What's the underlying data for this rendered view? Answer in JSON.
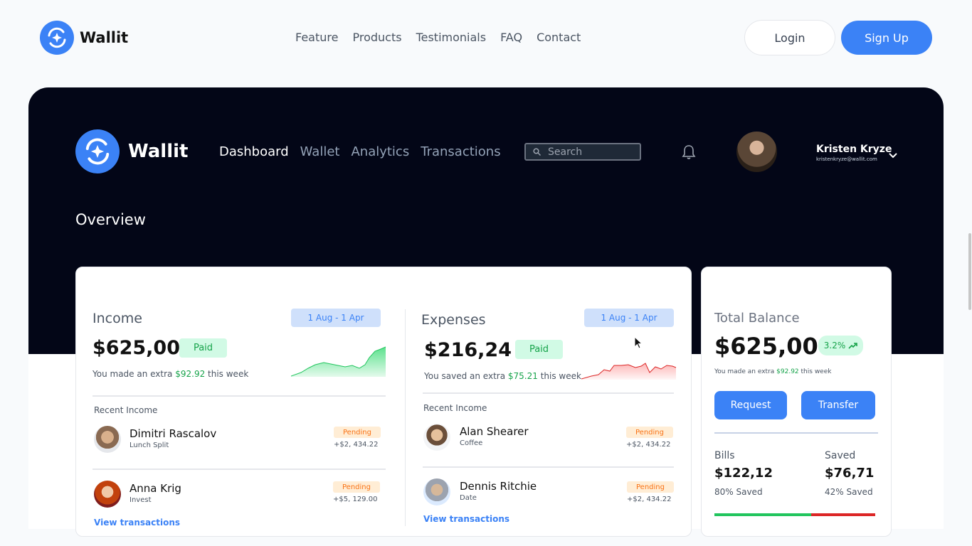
{
  "site": {
    "brand": "Wallit",
    "nav": [
      "Feature",
      "Products",
      "Testimonials",
      "FAQ",
      "Contact"
    ],
    "login": "Login",
    "signup": "Sign Up"
  },
  "dashboard": {
    "brand": "Wallit",
    "tabs": [
      "Dashboard",
      "Wallet",
      "Analytics",
      "Transactions"
    ],
    "active_tab": "Dashboard",
    "search_placeholder": "Search",
    "user": {
      "name": "Kristen Kryze",
      "email": "kristenkryze@wallit.com"
    },
    "overview": "Overview"
  },
  "income": {
    "title": "Income",
    "date_range": "1 Aug - 1 Apr",
    "amount": "$625,00",
    "status": "Paid",
    "note_pre": "You made an extra ",
    "note_val": "$92.92",
    "note_post": " this week",
    "recent_label": "Recent Income",
    "items": [
      {
        "name": "Dimitri Rascalov",
        "sub": "Lunch Split",
        "status": "Pending",
        "amount": "+$2, 434.22"
      },
      {
        "name": "Anna Krig",
        "sub": "Invest",
        "status": "Pending",
        "amount": "+$5, 129.00"
      }
    ],
    "view_link": "View transactions"
  },
  "expenses": {
    "title": "Expenses",
    "date_range": "1 Aug - 1 Apr",
    "amount": "$216,24",
    "status": "Paid",
    "note_pre": "You saved an extra ",
    "note_val": "$75.21",
    "note_post": " this week",
    "recent_label": "Recent Income",
    "items": [
      {
        "name": "Alan Shearer",
        "sub": "Coffee",
        "status": "Pending",
        "amount": "+$2, 434.22"
      },
      {
        "name": "Dennis Ritchie",
        "sub": "Date",
        "status": "Pending",
        "amount": "+$2, 434.22"
      }
    ],
    "view_link": "View transactions"
  },
  "balance": {
    "title": "Total Balance",
    "amount": "$625,00",
    "change": "3.2%",
    "note_pre": "You made an extra ",
    "note_val": "$92.92",
    "note_post": " this week",
    "request": "Request",
    "transfer": "Transfer",
    "bills": {
      "label": "Bills",
      "value": "$122,12",
      "sub": "80% Saved"
    },
    "saved": {
      "label": "Saved",
      "value": "$76,71",
      "sub": "42% Saved"
    },
    "bills_share": 0.6
  },
  "colors": {
    "accent": "#3b82f6",
    "dark": "#030617",
    "positive": "#16a34a",
    "negative": "#dc2626",
    "pending": "#f97316"
  },
  "icons": [
    "logo-icon",
    "search-icon",
    "bell-icon",
    "chevron-down-icon",
    "trend-up-icon",
    "cursor-icon"
  ]
}
